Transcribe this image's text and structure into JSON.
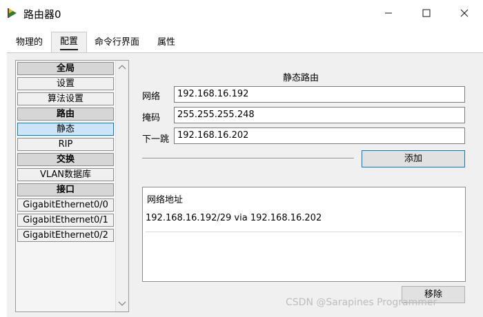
{
  "window": {
    "title": "路由器0",
    "app_icon": "router-icon",
    "controls": {
      "minimize": "minimize-icon",
      "maximize": "maximize-icon",
      "close": "close-icon"
    }
  },
  "tabs": [
    {
      "label": "物理的",
      "active": false
    },
    {
      "label": "配置",
      "active": true
    },
    {
      "label": "命令行界面",
      "active": false
    },
    {
      "label": "属性",
      "active": false
    }
  ],
  "sidebar": {
    "items": [
      {
        "label": "全局",
        "type": "header"
      },
      {
        "label": "设置",
        "type": "item"
      },
      {
        "label": "算法设置",
        "type": "item"
      },
      {
        "label": "路由",
        "type": "header"
      },
      {
        "label": "静态",
        "type": "item",
        "selected": true
      },
      {
        "label": "RIP",
        "type": "item"
      },
      {
        "label": "交换",
        "type": "header"
      },
      {
        "label": "VLAN数据库",
        "type": "item"
      },
      {
        "label": "接口",
        "type": "header"
      },
      {
        "label": "GigabitEthernet0/0",
        "type": "item"
      },
      {
        "label": "GigabitEthernet0/1",
        "type": "item"
      },
      {
        "label": "GigabitEthernet0/2",
        "type": "item"
      }
    ]
  },
  "static_route": {
    "title": "静态路由",
    "network_label": "网络",
    "network_value": "192.168.16.192",
    "mask_label": "掩码",
    "mask_value": "255.255.255.248",
    "next_hop_label": "下一跳",
    "next_hop_value": "192.168.16.202",
    "add_button": "添加",
    "list_header": "网络地址",
    "routes": [
      "192.168.16.192/29 via 192.168.16.202"
    ],
    "remove_button": "移除"
  },
  "watermark": "CSDN @Sarapines Programmer",
  "colors": {
    "selected_bg": "#cce4f7",
    "selected_border": "#0078d7",
    "panel_bg": "#f0f0f0"
  }
}
